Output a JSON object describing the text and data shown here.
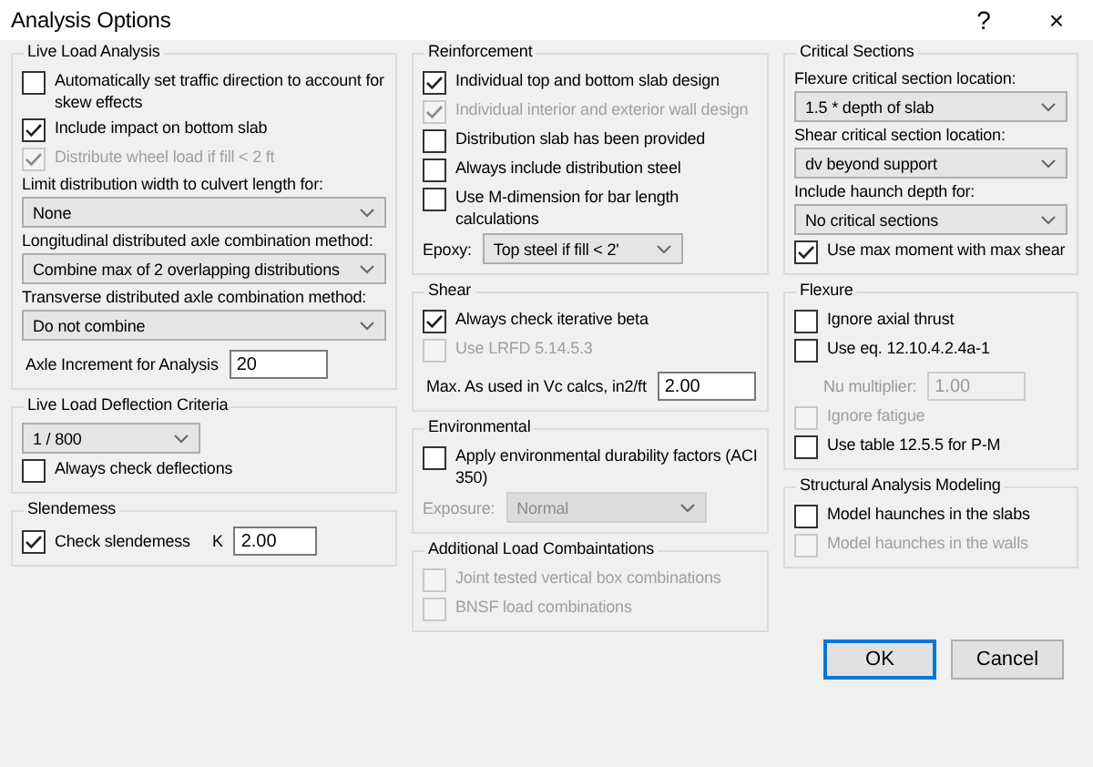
{
  "window": {
    "title": "Analysis Options",
    "help": "?",
    "close": "×"
  },
  "columns": [
    {
      "groups": [
        {
          "title": "Live Load Analysis",
          "items": [
            {
              "kind": "check",
              "label": "Automatically set traffic direction to account for skew effects",
              "checked": false,
              "disabled": false
            },
            {
              "kind": "check",
              "label": "Include impact on bottom slab",
              "checked": true,
              "disabled": false
            },
            {
              "kind": "check",
              "label": "Distribute wheel load if fill < 2 ft",
              "checked": true,
              "disabled": true
            },
            {
              "kind": "label",
              "text": "Limit distribution width to culvert length for:"
            },
            {
              "kind": "select",
              "value": "None",
              "disabled": false
            },
            {
              "kind": "label",
              "text": "Longitudinal distributed axle combination method:"
            },
            {
              "kind": "select",
              "value": "Combine max of 2 overlapping distributions",
              "disabled": false
            },
            {
              "kind": "label",
              "text": "Transverse distributed axle combination method:"
            },
            {
              "kind": "select",
              "value": "Do not combine",
              "disabled": false
            },
            {
              "kind": "field",
              "label": "Axle Increment for Analysis",
              "value": "20",
              "disabled": false
            }
          ]
        },
        {
          "title": "Live Load Deflection Criteria",
          "items": [
            {
              "kind": "short-select",
              "value": "1 / 800",
              "disabled": false
            },
            {
              "kind": "check",
              "label": "Always check deflections",
              "checked": false,
              "disabled": false
            }
          ]
        },
        {
          "title": "Slendemess",
          "items": [
            {
              "kind": "check-field",
              "label": "Check slendemess",
              "checked": true,
              "disabled": false,
              "field_label": "K",
              "value": "2.00"
            }
          ]
        }
      ]
    },
    {
      "groups": [
        {
          "title": "Reinforcement",
          "items": [
            {
              "kind": "check",
              "label": "Individual top and bottom slab design",
              "checked": true,
              "disabled": false
            },
            {
              "kind": "check",
              "label": "Individual interior and exterior wall design",
              "checked": true,
              "disabled": true
            },
            {
              "kind": "check",
              "label": "Distribution slab has been provided",
              "checked": false,
              "disabled": false
            },
            {
              "kind": "check",
              "label": "Always include distribution steel",
              "checked": false,
              "disabled": false
            },
            {
              "kind": "check",
              "label": "Use M-dimension for bar length calculations",
              "checked": false,
              "disabled": false
            },
            {
              "kind": "inline-select",
              "label": "Epoxy:",
              "value": "Top steel if fill < 2'",
              "disabled": false
            }
          ]
        },
        {
          "title": "Shear",
          "items": [
            {
              "kind": "check",
              "label": "Always check iterative beta",
              "checked": true,
              "disabled": false
            },
            {
              "kind": "check",
              "label": "Use LRFD 5.14.5.3",
              "checked": false,
              "disabled": true
            },
            {
              "kind": "field",
              "label": "Max. As used in Vc calcs, in2/ft",
              "value": "2.00",
              "disabled": false
            }
          ]
        },
        {
          "title": "Environmental",
          "items": [
            {
              "kind": "check",
              "label": "Apply environmental durability factors (ACI 350)",
              "checked": false,
              "disabled": false
            },
            {
              "kind": "inline-select",
              "label": "Exposure:",
              "value": "Normal",
              "disabled": true
            }
          ]
        },
        {
          "title": "Additional Load Combaintations",
          "items": [
            {
              "kind": "check",
              "label": "Joint tested vertical box combinations",
              "checked": false,
              "disabled": true
            },
            {
              "kind": "check",
              "label": "BNSF load combinations",
              "checked": false,
              "disabled": true
            }
          ]
        }
      ]
    },
    {
      "groups": [
        {
          "title": "Critical Sections",
          "items": [
            {
              "kind": "label",
              "text": "Flexure critical section location:"
            },
            {
              "kind": "select",
              "value": "1.5 * depth of slab",
              "disabled": false
            },
            {
              "kind": "label",
              "text": "Shear critical section location:"
            },
            {
              "kind": "select",
              "value": "dv beyond support",
              "disabled": false
            },
            {
              "kind": "label",
              "text": "Include haunch depth for:"
            },
            {
              "kind": "select",
              "value": "No critical sections",
              "disabled": false
            },
            {
              "kind": "check",
              "label": "Use max moment with max shear",
              "checked": true,
              "disabled": false
            }
          ]
        },
        {
          "title": "Flexure",
          "items": [
            {
              "kind": "check",
              "label": "Ignore axial thrust",
              "checked": false,
              "disabled": false
            },
            {
              "kind": "check",
              "label": "Use eq. 12.10.4.2.4a-1",
              "checked": false,
              "disabled": false
            },
            {
              "kind": "field",
              "label": "Nu multiplier:",
              "value": "1.00",
              "disabled": true
            },
            {
              "kind": "check",
              "label": "Ignore fatigue",
              "checked": false,
              "disabled": true
            },
            {
              "kind": "check",
              "label": "Use table 12.5.5 for P-M",
              "checked": false,
              "disabled": false
            }
          ]
        },
        {
          "title": "Structural Analysis Modeling",
          "items": [
            {
              "kind": "check",
              "label": "Model haunches in the slabs",
              "checked": false,
              "disabled": false
            },
            {
              "kind": "check",
              "label": "Model haunches in the walls",
              "checked": false,
              "disabled": true
            }
          ]
        }
      ]
    }
  ],
  "buttons": [
    {
      "label": "OK",
      "default": true
    },
    {
      "label": "Cancel",
      "default": false
    }
  ]
}
